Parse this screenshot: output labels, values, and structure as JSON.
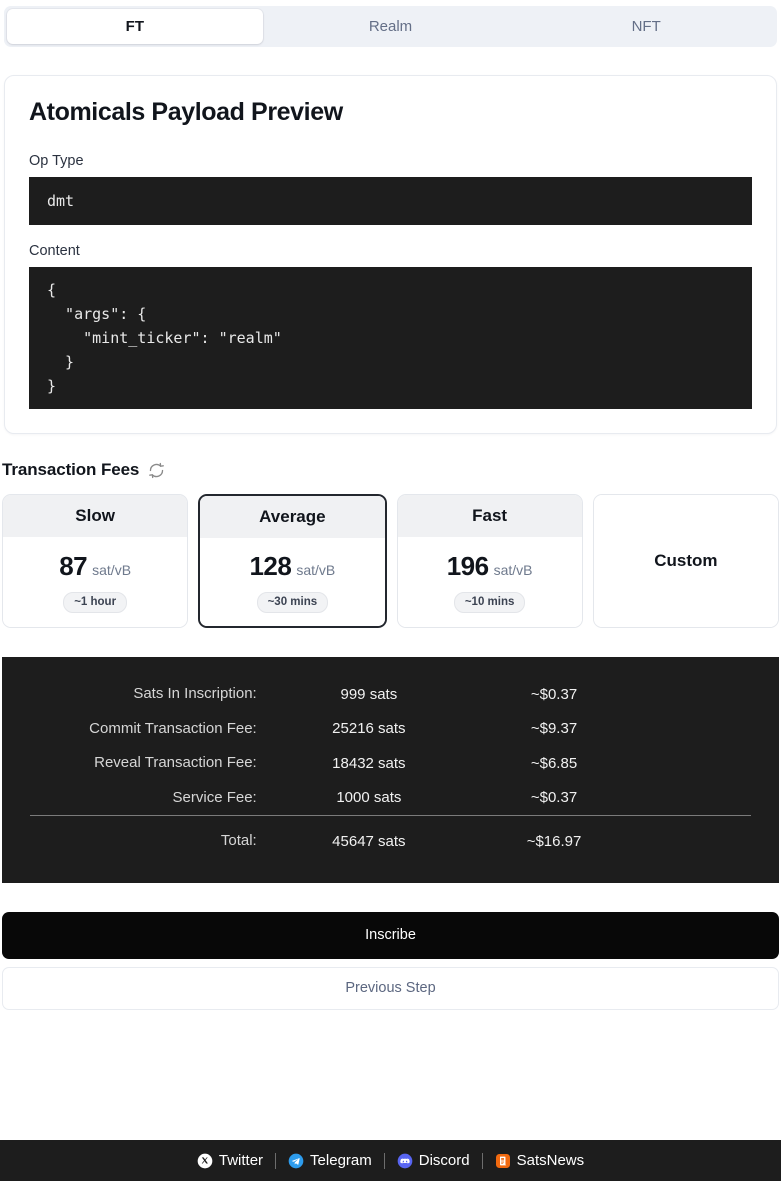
{
  "tabs": {
    "items": [
      {
        "label": "FT",
        "active": true
      },
      {
        "label": "Realm",
        "active": false
      },
      {
        "label": "NFT",
        "active": false
      }
    ]
  },
  "preview": {
    "title": "Atomicals Payload Preview",
    "op_type_label": "Op Type",
    "op_type_value": "dmt",
    "content_label": "Content",
    "content_value": "{\n  \"args\": {\n    \"mint_ticker\": \"realm\"\n  }\n}"
  },
  "fees": {
    "heading": "Transaction Fees",
    "refresh_icon": "refresh-icon",
    "options": [
      {
        "name": "Slow",
        "rate": "87",
        "unit": "sat/vB",
        "eta": "~1 hour",
        "selected": false,
        "custom": false
      },
      {
        "name": "Average",
        "rate": "128",
        "unit": "sat/vB",
        "eta": "~30 mins",
        "selected": true,
        "custom": false
      },
      {
        "name": "Fast",
        "rate": "196",
        "unit": "sat/vB",
        "eta": "~10 mins",
        "selected": false,
        "custom": false
      },
      {
        "name": "Custom",
        "rate": "",
        "unit": "",
        "eta": "",
        "selected": false,
        "custom": true
      }
    ]
  },
  "summary": {
    "rows": [
      {
        "label": "Sats In Inscription:",
        "sats": "999 sats",
        "usd": "~$0.37",
        "total": false
      },
      {
        "label": "Commit Transaction Fee:",
        "sats": "25216 sats",
        "usd": "~$9.37",
        "total": false
      },
      {
        "label": "Reveal Transaction Fee:",
        "sats": "18432 sats",
        "usd": "~$6.85",
        "total": false
      },
      {
        "label": "Service Fee:",
        "sats": "1000 sats",
        "usd": "~$0.37",
        "total": false
      },
      {
        "label": "Total:",
        "sats": "45647 sats",
        "usd": "~$16.97",
        "total": true
      }
    ]
  },
  "actions": {
    "primary_label": "Inscribe",
    "secondary_label": "Previous Step"
  },
  "footer": {
    "links": [
      {
        "label": "Twitter",
        "icon": "twitter-x-icon"
      },
      {
        "label": "Telegram",
        "icon": "telegram-icon"
      },
      {
        "label": "Discord",
        "icon": "discord-icon"
      },
      {
        "label": "SatsNews",
        "icon": "satsnews-icon"
      }
    ]
  },
  "colors": {
    "dark_panel": "#1d1d1d",
    "primary_button": "#080808",
    "tab_strip": "#eef1f6",
    "muted_text": "#646f87",
    "twitter": "#ffffff",
    "telegram": "#2d9ced",
    "discord": "#5865f2",
    "satsnews": "#f1690f"
  }
}
